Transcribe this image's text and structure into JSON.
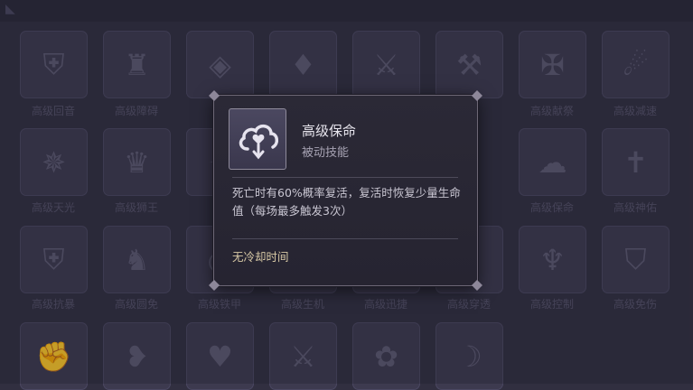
{
  "tooltip": {
    "name": "高级保命",
    "type": "被动技能",
    "description": "死亡时有60%概率复活，复活时恢复少量生命值（每场最多触发3次）",
    "cooldown": "无冷却时间"
  },
  "grid_labels": {
    "row1": [
      "高级回音",
      "高级障碍",
      "",
      "",
      "",
      "",
      "高级献祭",
      "高级减速"
    ],
    "row2": [
      "高级天光",
      "高级狮王",
      "",
      "",
      "",
      "",
      "高级保命",
      "高级神佑"
    ],
    "row3": [
      "高级抗暴",
      "高级圆免",
      "高级铁甲",
      "高级生机",
      "高级迅捷",
      "高级穿透",
      "高级控制",
      "高级免伤"
    ]
  }
}
